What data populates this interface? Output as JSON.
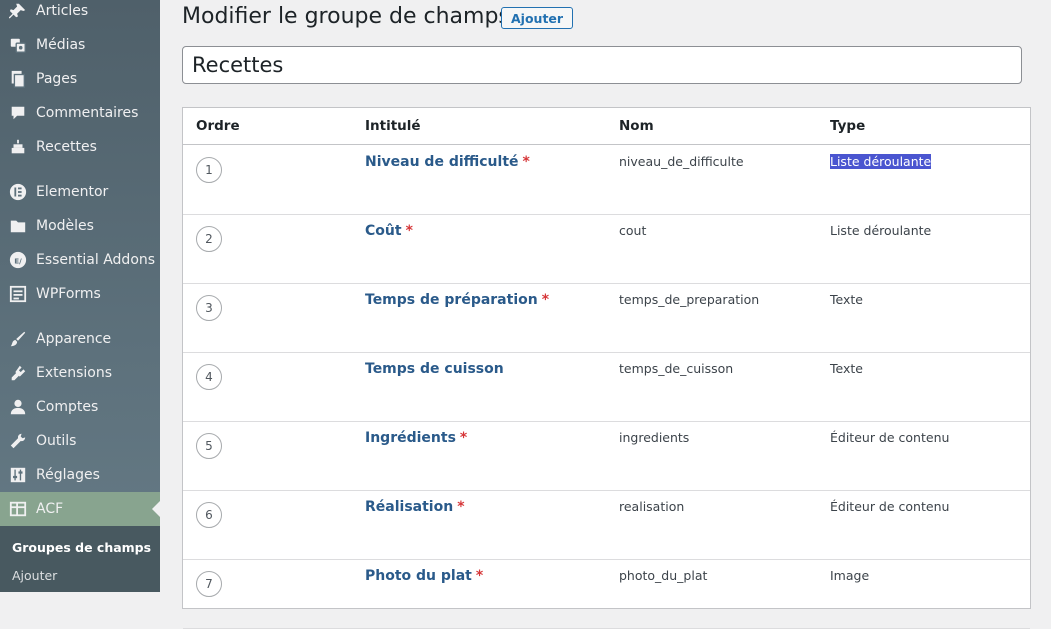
{
  "sidebar": {
    "items": [
      {
        "label": "Articles",
        "icon": "pin-icon"
      },
      {
        "label": "Médias",
        "icon": "media-icon"
      },
      {
        "label": "Pages",
        "icon": "pages-icon"
      },
      {
        "label": "Commentaires",
        "icon": "comment-icon"
      },
      {
        "label": "Recettes",
        "icon": "cake-icon"
      },
      {
        "label": "Elementor",
        "icon": "elementor-icon"
      },
      {
        "label": "Modèles",
        "icon": "folder-icon"
      },
      {
        "label": "Essential Addons",
        "icon": "essential-addons-icon"
      },
      {
        "label": "WPForms",
        "icon": "wpforms-icon"
      },
      {
        "label": "Apparence",
        "icon": "brush-icon"
      },
      {
        "label": "Extensions",
        "icon": "plugin-icon"
      },
      {
        "label": "Comptes",
        "icon": "user-icon"
      },
      {
        "label": "Outils",
        "icon": "wrench-icon"
      },
      {
        "label": "Réglages",
        "icon": "settings-icon"
      },
      {
        "label": "ACF",
        "icon": "acf-icon"
      }
    ],
    "submenu": [
      {
        "label": "Groupes de champs"
      },
      {
        "label": "Ajouter"
      }
    ]
  },
  "main": {
    "title": "Modifier le groupe de champs",
    "add_button": "Ajouter",
    "group_title_value": "Recettes"
  },
  "table": {
    "headers": {
      "order": "Ordre",
      "label": "Intitulé",
      "name": "Nom",
      "type": "Type"
    },
    "rows": [
      {
        "order": "1",
        "label": "Niveau de difficulté",
        "required": "*",
        "name": "niveau_de_difficulte",
        "type": "Liste déroulante"
      },
      {
        "order": "2",
        "label": "Coût",
        "required": "*",
        "name": "cout",
        "type": "Liste déroulante"
      },
      {
        "order": "3",
        "label": "Temps de préparation",
        "required": "*",
        "name": "temps_de_preparation",
        "type": "Texte"
      },
      {
        "order": "4",
        "label": "Temps de cuisson",
        "required": "",
        "name": "temps_de_cuisson",
        "type": "Texte"
      },
      {
        "order": "5",
        "label": "Ingrédients",
        "required": "*",
        "name": "ingredients",
        "type": "Éditeur de contenu"
      },
      {
        "order": "6",
        "label": "Réalisation",
        "required": "*",
        "name": "realisation",
        "type": "Éditeur de contenu"
      },
      {
        "order": "7",
        "label": "Photo du plat",
        "required": "*",
        "name": "photo_du_plat",
        "type": "Image"
      }
    ]
  },
  "colors": {
    "sidebar": "#5d717c",
    "active": "#88a48f",
    "link": "#2a5a8a",
    "required": "#d63638",
    "selection": "#4a55d0"
  }
}
